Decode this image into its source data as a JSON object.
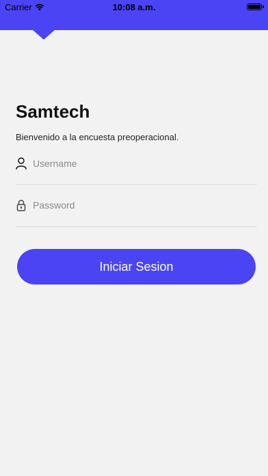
{
  "status_bar": {
    "carrier": "Carrier",
    "time": "10:08 a.m.",
    "wifi_icon": "wifi-icon",
    "battery_icon": "battery-icon"
  },
  "colors": {
    "accent": "#4a44f4",
    "background": "#f2f2f2"
  },
  "login": {
    "title": "Samtech",
    "subtitle": "Bienvenido a la encuesta preoperacional.",
    "username": {
      "icon": "user-icon",
      "placeholder": "Username",
      "value": ""
    },
    "password": {
      "icon": "lock-icon",
      "placeholder": "Password",
      "value": ""
    },
    "submit_label": "Iniciar Sesion"
  }
}
